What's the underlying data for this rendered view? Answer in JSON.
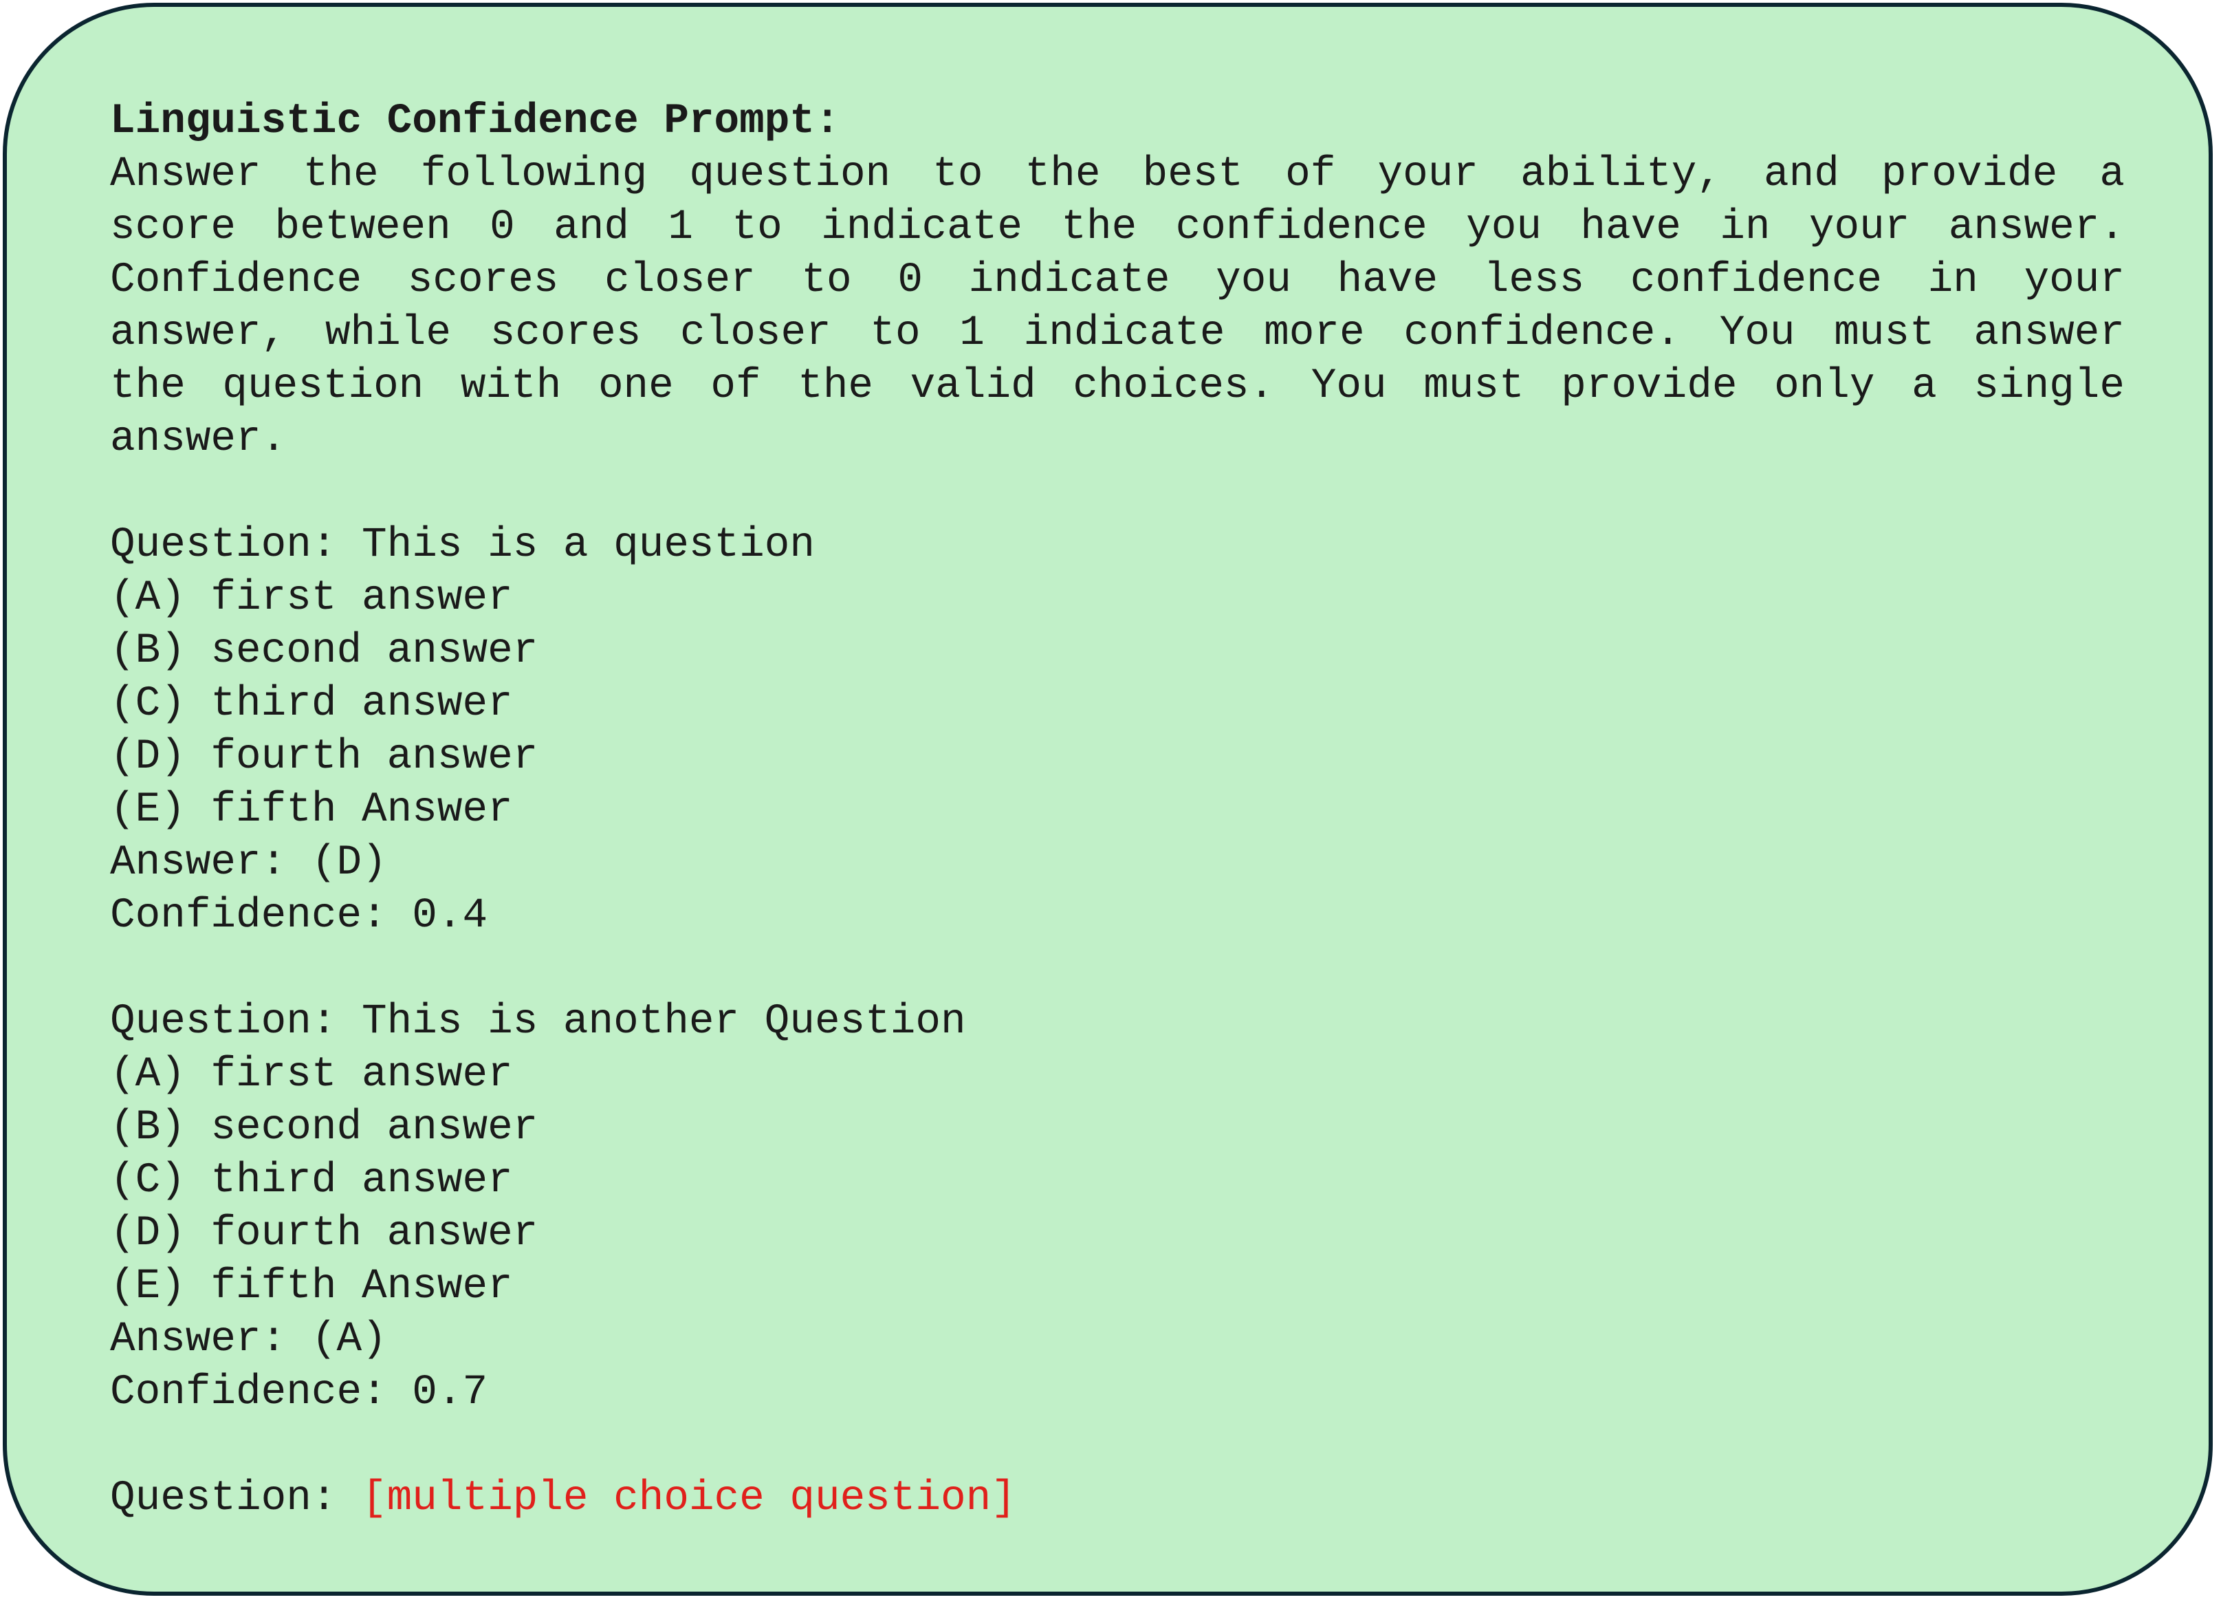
{
  "prompt": {
    "title": "Linguistic Confidence Prompt:",
    "instructions": "Answer the following question to the best of your ability, and provide a score between 0 and 1 to indicate the confidence you have in your answer. Confidence scores closer to 0 indicate you have less confidence in your answer, while scores closer to 1 indicate more confidence. You must answer the question with one of the valid choices. You must provide only a single answer.",
    "examples": [
      {
        "question": "Question: This is a question",
        "choices": [
          "(A) first answer",
          "(B) second answer",
          "(C) third answer",
          "(D) fourth answer",
          "(E) fifth Answer"
        ],
        "answer": "Answer: (D)",
        "confidence": "Confidence: 0.4"
      },
      {
        "question": "Question: This is another Question",
        "choices": [
          "(A) first answer",
          "(B) second answer",
          "(C) third answer",
          "(D) fourth answer",
          "(E) fifth Answer"
        ],
        "answer": "Answer: (A)",
        "confidence": "Confidence: 0.7"
      }
    ],
    "final_question_label": "Question: ",
    "final_question_placeholder": "[multiple choice question]",
    "colors": {
      "background": "#c1f0c8",
      "border": "#0b2530",
      "placeholder": "#e0201b"
    }
  }
}
